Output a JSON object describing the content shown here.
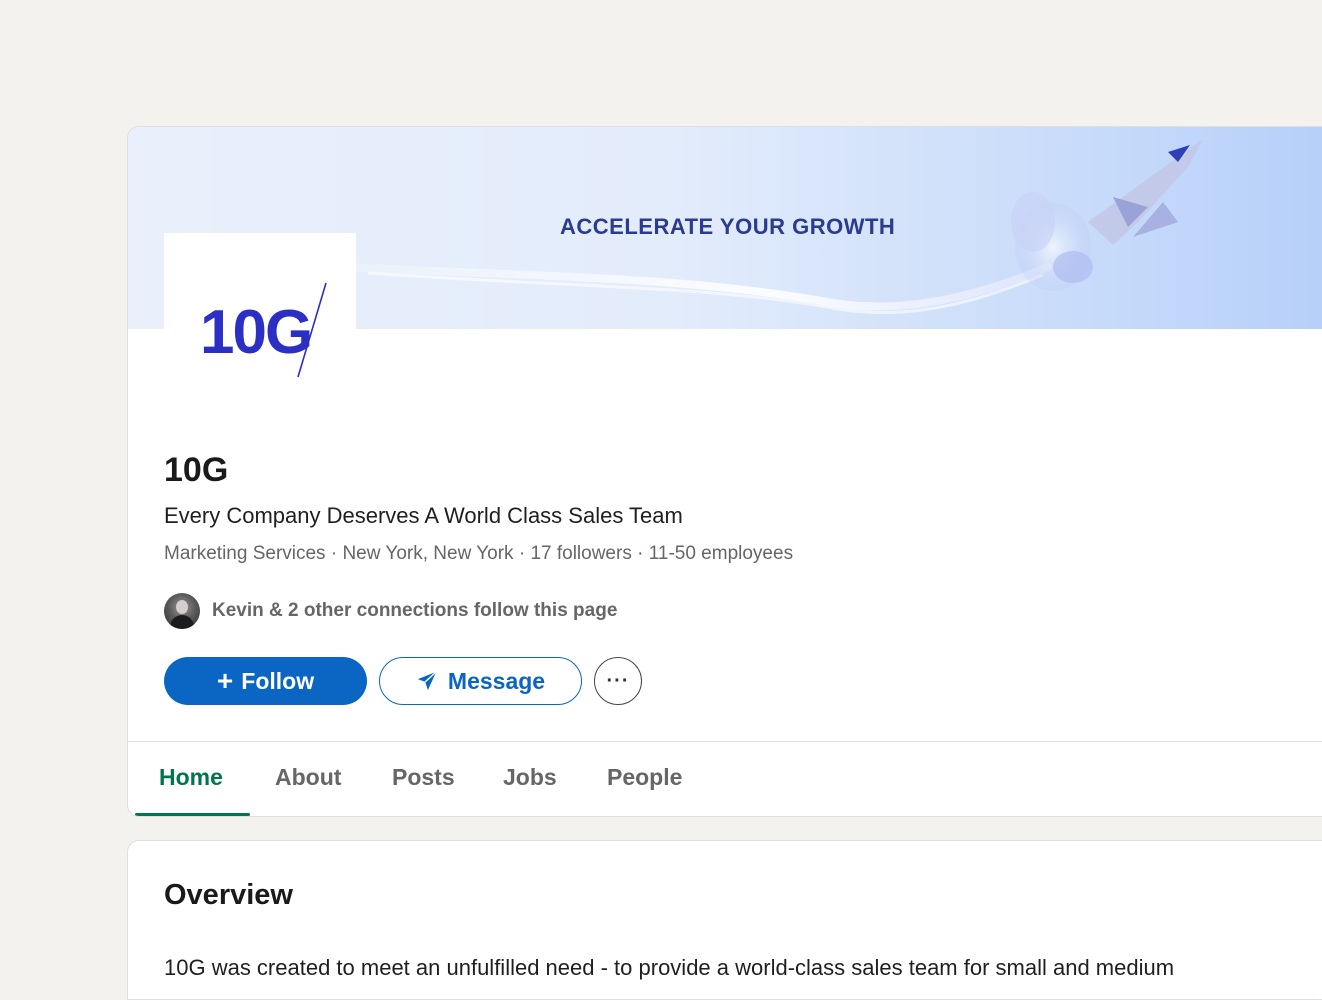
{
  "banner": {
    "headline": "ACCELERATE YOUR GROWTH"
  },
  "logo": {
    "text": "10G"
  },
  "company": {
    "name": "10G",
    "tagline": "Every Company Deserves A World Class Sales Team",
    "industry": "Marketing Services",
    "location": "New York, New York",
    "followers": "17 followers",
    "employees": "11-50 employees"
  },
  "connections": {
    "text": "Kevin & 2 other connections follow this page"
  },
  "actions": {
    "follow_label": "Follow",
    "message_label": "Message",
    "more_label": "···"
  },
  "tabs": [
    {
      "label": "Home",
      "active": true
    },
    {
      "label": "About",
      "active": false
    },
    {
      "label": "Posts",
      "active": false
    },
    {
      "label": "Jobs",
      "active": false
    },
    {
      "label": "People",
      "active": false
    }
  ],
  "overview": {
    "title": "Overview",
    "body": "10G was created to meet an unfulfilled need - to provide a world-class sales team for small and medium"
  },
  "colors": {
    "page_bg": "#f4f2ee",
    "brand_blue": "#0a66c2",
    "active_tab_green": "#01754f",
    "logo_blue": "#2c2fc4",
    "banner_text": "#2b3b8f"
  }
}
